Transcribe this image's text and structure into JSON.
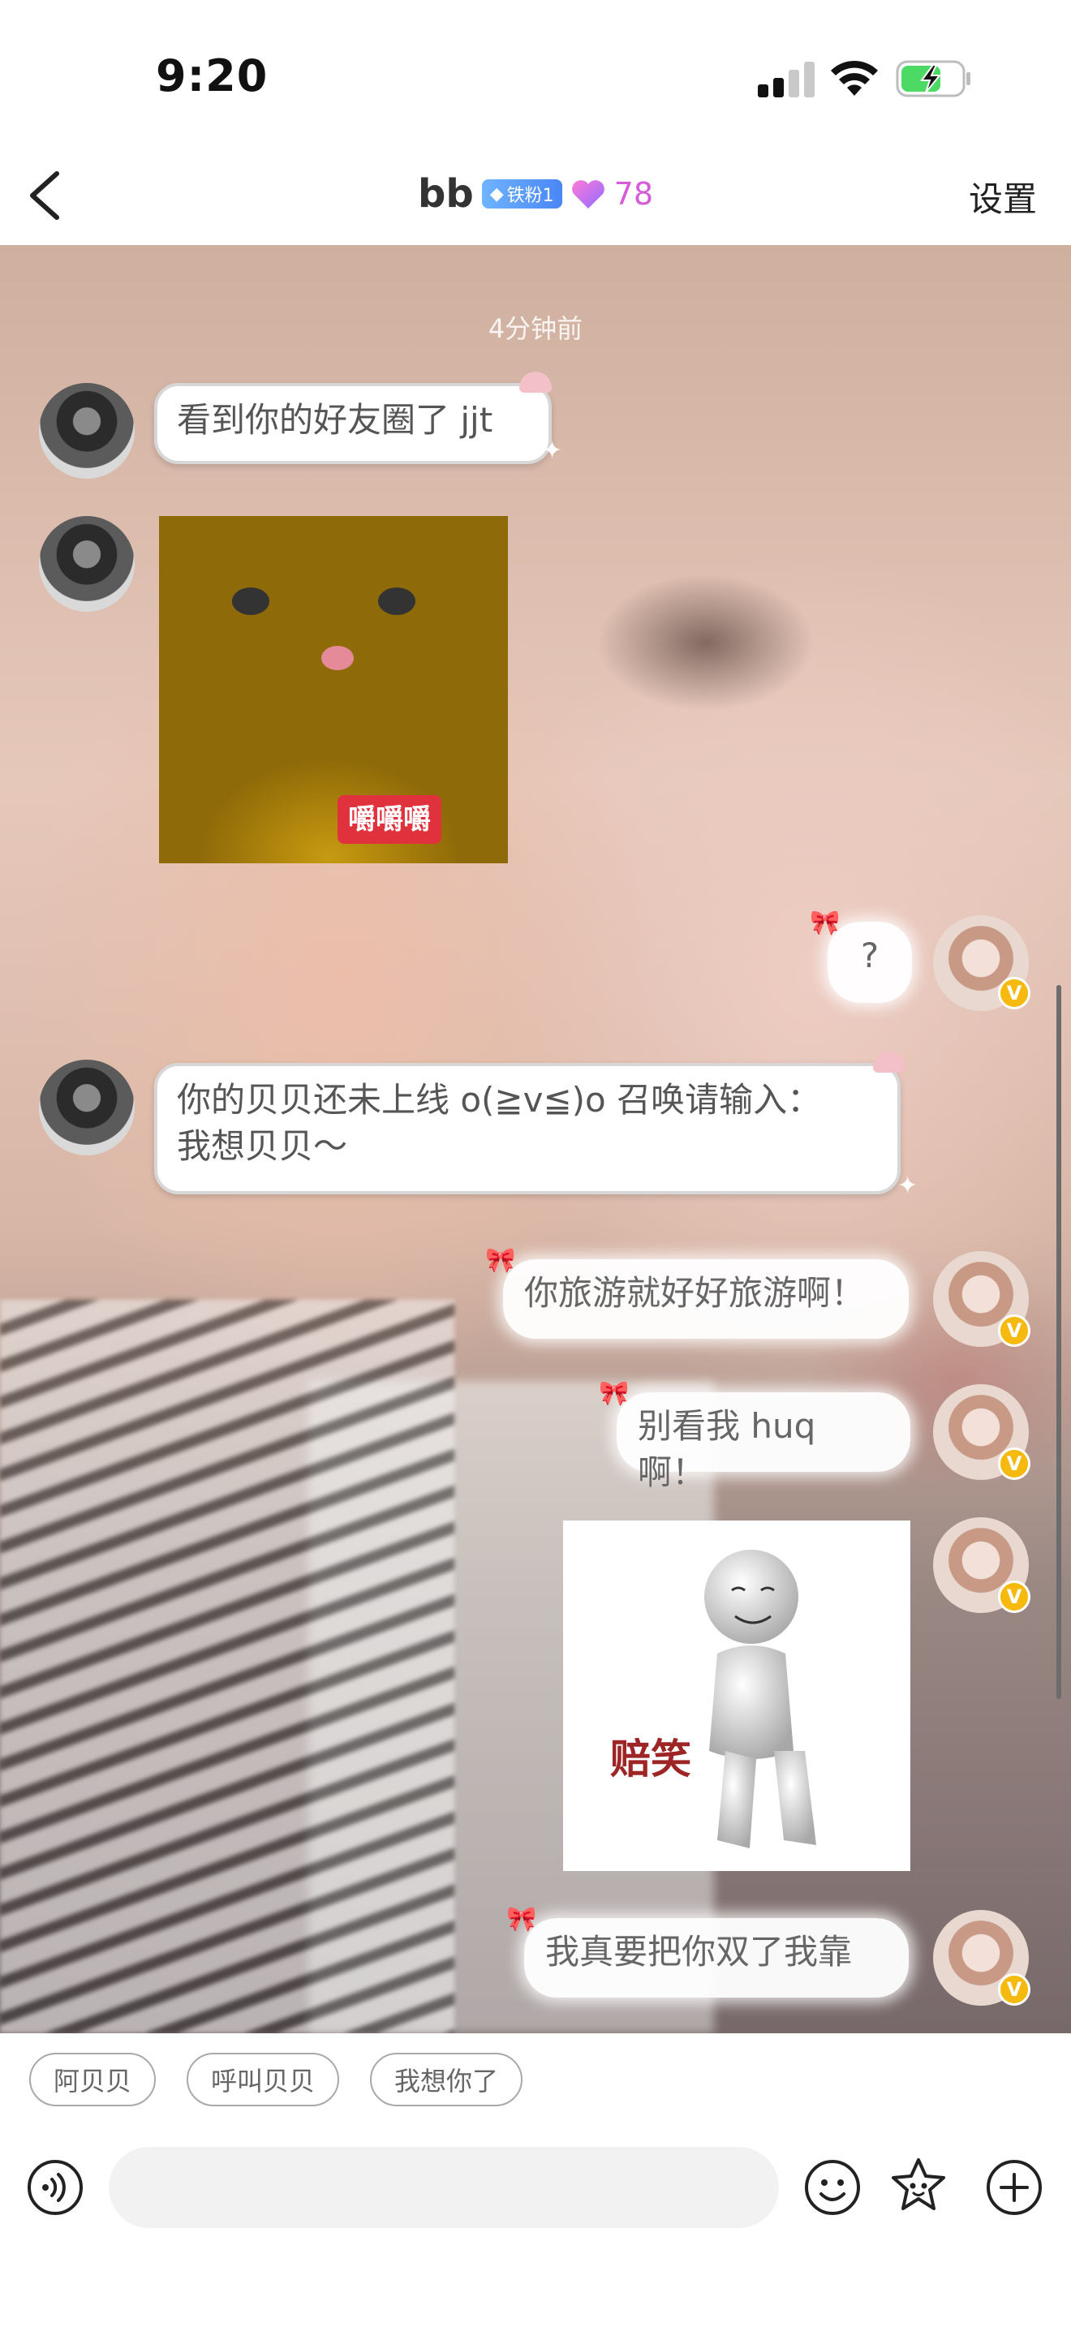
{
  "status_bar": {
    "time": "9:20"
  },
  "header": {
    "title": "bb",
    "fan_badge": "铁粉1",
    "heart_count": "78",
    "settings_label": "设置"
  },
  "chat": {
    "timestamp": "4分钟前",
    "messages": [
      {
        "side": "left",
        "type": "text",
        "text": "看到你的好友圈了 jjt"
      },
      {
        "side": "left",
        "type": "image",
        "caption": "嚼嚼嚼"
      },
      {
        "side": "right",
        "type": "text",
        "text": "?"
      },
      {
        "side": "left",
        "type": "text",
        "text_line1": "你的贝贝还未上线 o(≧v≦)o 召唤请输入：",
        "text_line2": "我想贝贝～"
      },
      {
        "side": "right",
        "type": "text",
        "text": "你旅游就好好旅游啊！"
      },
      {
        "side": "right",
        "type": "text",
        "text": "别看我 huq 啊！"
      },
      {
        "side": "right",
        "type": "image",
        "caption": "赔笑"
      },
      {
        "side": "right",
        "type": "text",
        "text": "我真要把你双了我靠"
      }
    ],
    "vip_badge": "V"
  },
  "quick_replies": [
    "阿贝贝",
    "呼叫贝贝",
    "我想你了"
  ],
  "icons": {
    "back": "chevron-left-icon",
    "voice": "voice-icon",
    "emoji": "emoji-icon",
    "sticker": "sticker-icon",
    "plus": "plus-icon"
  },
  "colors": {
    "heart": "#d65bd8",
    "fan_badge": "#4a86f5",
    "vip_badge": "#f6b90d",
    "cat_label": "#e0323d",
    "smile_label": "#9e2526"
  }
}
